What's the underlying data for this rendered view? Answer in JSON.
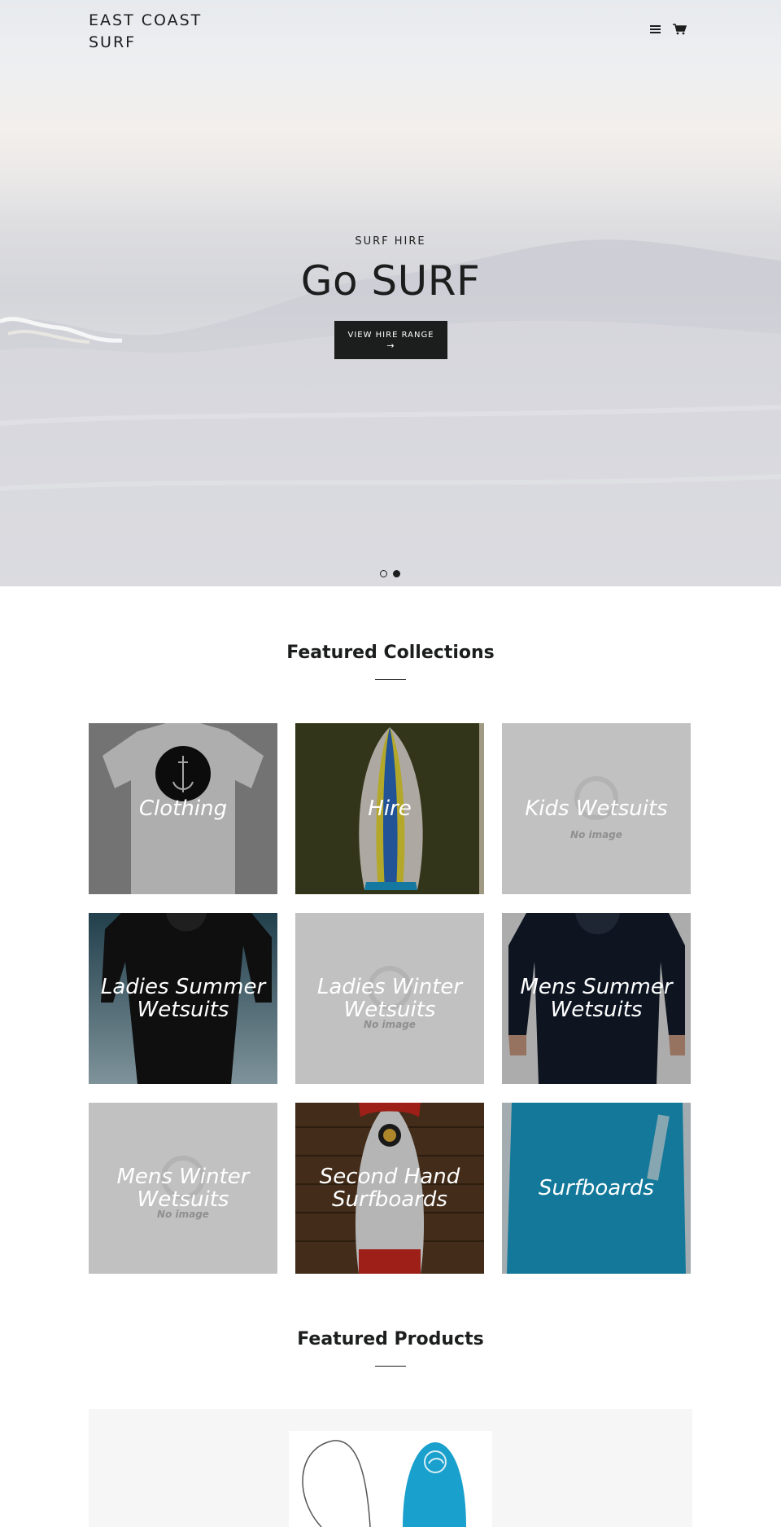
{
  "header": {
    "brand": "EAST COAST SURF",
    "menu_icon": "hamburger-menu-icon",
    "cart_icon": "cart-icon"
  },
  "hero": {
    "kicker": "SURF HIRE",
    "title": "Go SURF",
    "button_label": "VIEW HIRE RANGE",
    "button_arrow": "→",
    "slide_count": 2,
    "active_slide": 2
  },
  "featured_collections": {
    "title": "Featured Collections",
    "items": [
      {
        "label": "Clothing",
        "has_image": true
      },
      {
        "label": "Hire",
        "has_image": true
      },
      {
        "label": "Kids Wetsuits",
        "has_image": false,
        "placeholder": "No image"
      },
      {
        "label": "Ladies Summer Wetsuits",
        "has_image": true
      },
      {
        "label": "Ladies Winter Wetsuits",
        "has_image": false,
        "placeholder": "No image"
      },
      {
        "label": "Mens Summer Wetsuits",
        "has_image": true
      },
      {
        "label": "Mens Winter Wetsuits",
        "has_image": false,
        "placeholder": "No image"
      },
      {
        "label": "Second Hand Surfboards",
        "has_image": true
      },
      {
        "label": "Surfboards",
        "has_image": true
      }
    ]
  },
  "featured_products": {
    "title": "Featured Products"
  },
  "colors": {
    "text": "#1c1d1d",
    "button_bg": "#1c1d1d",
    "button_text": "#ffffff",
    "placeholder_tile": "#c1c1c1",
    "surfboard_blue": "#1aa0cc"
  }
}
